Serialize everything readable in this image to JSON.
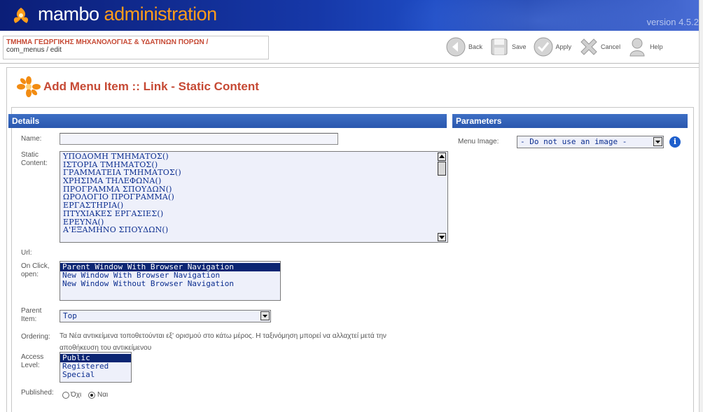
{
  "header": {
    "logo_word1": "mambo",
    "logo_word2": "administration",
    "version": "version 4.5.2"
  },
  "pathway": {
    "site_name": "ΤΜΗΜΑ ΓΕΩΡΓΙΚΗΣ ΜΗΧΑΝΟΛΟΓΙΑΣ & ΥΔΑΤΙΝΩΝ ΠΟΡΩΝ /",
    "path": "com_menus / edit"
  },
  "toolbar": {
    "back_label": "Back",
    "save_label": "Save",
    "apply_label": "Apply",
    "cancel_label": "Cancel",
    "help_label": "Help"
  },
  "page": {
    "title": "Add Menu Item :: Link - Static Content"
  },
  "details": {
    "header": "Details",
    "name_label": "Name:",
    "name_value": "",
    "static_label": "Static Content:",
    "static_options": [
      "ΥΠΟΔΟΜΗ ΤΜΗΜΑΤΟΣ()",
      "ΙΣΤΟΡΙΑ ΤΜΗΜΑΤΟΣ()",
      "ΓΡΑΜΜΑΤΕΙΑ ΤΜΗΜΑΤΟΣ()",
      "ΧΡΗΣΙΜΑ ΤΗΛΕΦΩΝΑ()",
      "ΠΡΟΓΡΑΜΜΑ ΣΠΟΥΔΩΝ()",
      "ΩΡΟΛΟΓΙΟ ΠΡΟΓΡΑΜΜΑ()",
      "ΕΡΓΑΣΤΗΡΙΑ()",
      "ΠΤΥΧΙΑΚΕΣ ΕΡΓΑΣΙΕΣ()",
      "ΕΡΕΥΝΑ()",
      "Α'ΕΞΑΜΗΝΟ ΣΠΟΥΔΩΝ()"
    ],
    "url_label": "Url:",
    "onclick_label": "On Click, open:",
    "onclick_options": [
      "Parent Window With Browser Navigation",
      "New Window With Browser Navigation",
      "New Window Without Browser Navigation"
    ],
    "onclick_selected": 0,
    "parent_label": "Parent Item:",
    "parent_value": "Top",
    "ordering_label": "Ordering:",
    "ordering_text_1": "Τα Νέα αντικείμενα τοποθετούνται εξ' ορισμού στο κάτω μέρος. Η ταξινόμηση μπορεί να αλλαχτεί μετά την",
    "ordering_text_2": "αποθήκευση του αντικείμενου",
    "access_label": "Access Level:",
    "access_options": [
      "Public",
      "Registered",
      "Special"
    ],
    "access_selected": 0,
    "published_label": "Published:",
    "published_no": "Όχι",
    "published_yes": "Ναι",
    "published_value": "yes"
  },
  "parameters": {
    "header": "Parameters",
    "menu_image_label": "Menu Image:",
    "menu_image_value": "- Do not use an image -",
    "info_glyph": "i"
  },
  "colors": {
    "brand_orange": "#ff9c1a",
    "title_red": "#c64934",
    "panel_blue": "#2a57ae",
    "select_blue": "#0b2573"
  }
}
